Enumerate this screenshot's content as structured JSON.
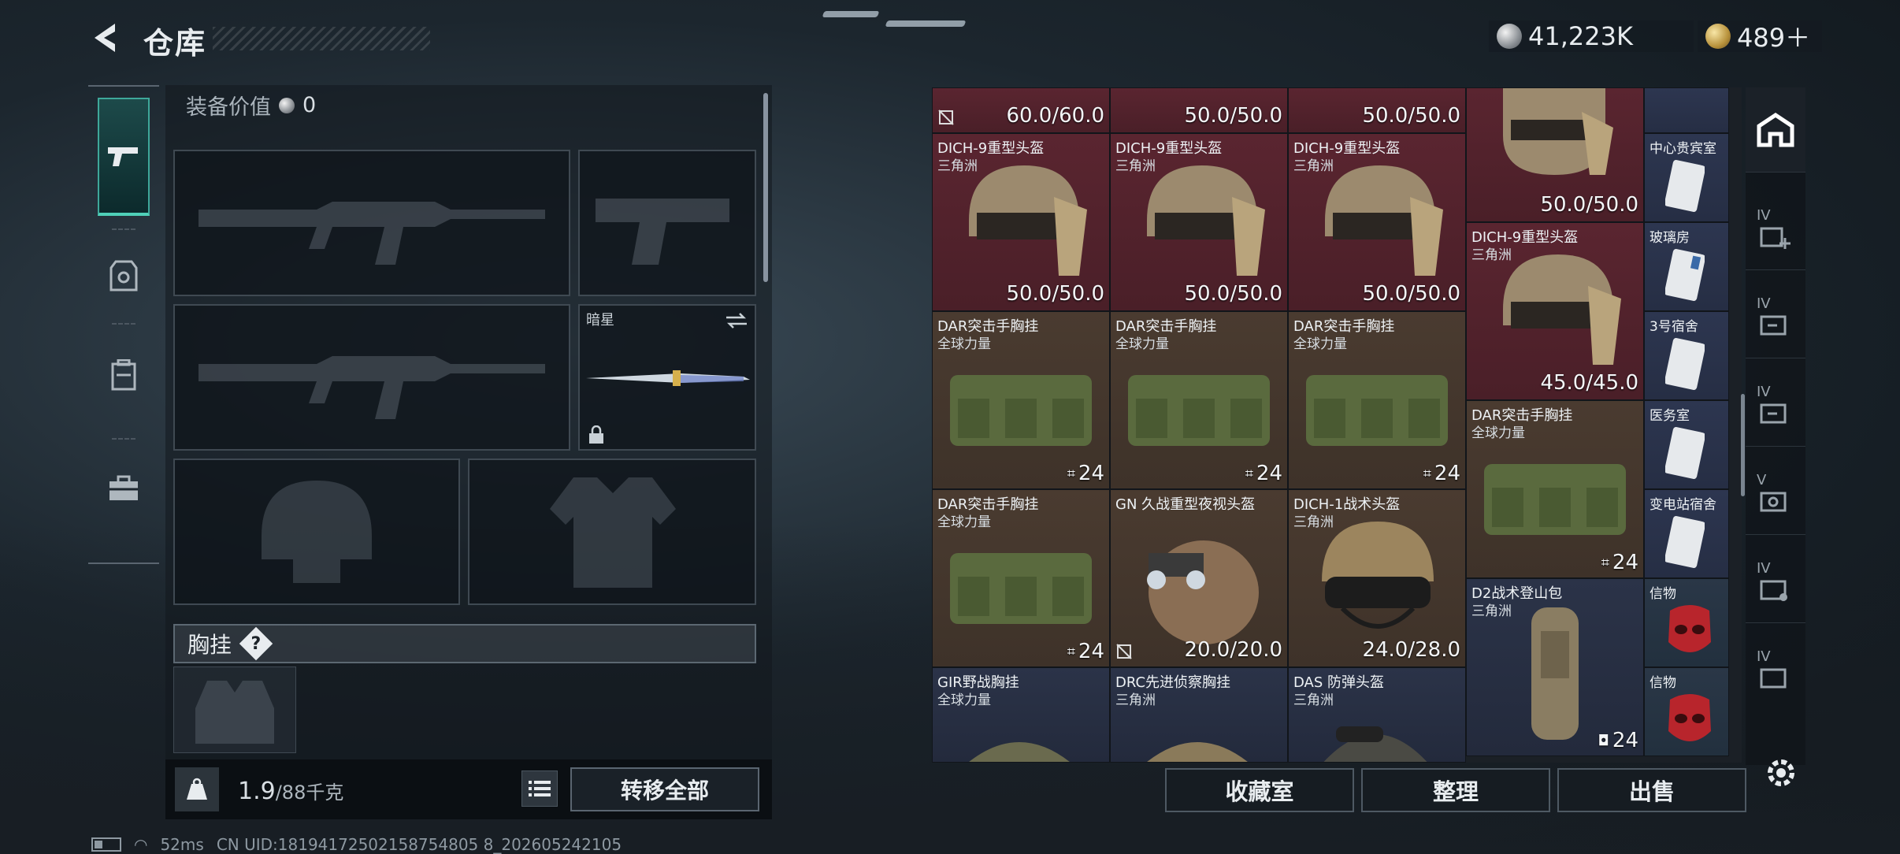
{
  "header": {
    "title": "仓库",
    "currency_silver": "41,223K",
    "currency_gold": "489＋"
  },
  "loadout": {
    "equip_value_label": "装备价值",
    "equip_value": "0",
    "melee_label": "暗星",
    "chest_label": "胸挂",
    "chest_help": "?"
  },
  "weight": {
    "current": "1.9",
    "max": "/88千克"
  },
  "buttons": {
    "transfer_all": "转移全部",
    "collection": "收藏室",
    "sort": "整理",
    "sell": "出售"
  },
  "inventory": {
    "row0": [
      "60.0/60.0",
      "50.0/50.0",
      "50.0/50.0"
    ],
    "helmet_name": "DICH-9重型头盔",
    "brand_delta": "三角洲",
    "brand_global": "全球力量",
    "rig_name": "DAR突击手胸挂",
    "helmet_dur": "50.0/50.0",
    "helmet_dur2": "45.0/45.0",
    "cap24": "24",
    "gn_name": "GN 久战重型夜视头盔",
    "gn_dur": "20.0/20.0",
    "dich1_name": "DICH-1战术头盔",
    "dich1_dur": "24.0/28.0",
    "d2_name": "D2战术登山包",
    "gir_name": "GIR野战胸挂",
    "drc_name": "DRC先进侦察胸挂",
    "das_name": "DAS 防弹头盔",
    "keys": [
      "中心贵宾室",
      "玻璃房",
      "3号宿舍",
      "医务室",
      "变电站宿舍",
      "信物",
      "信物"
    ]
  },
  "rightnav": {
    "tier": "IV",
    "tier_v": "V"
  },
  "status": {
    "ping": "52ms",
    "uid": "CN UID:18194172502158754805 8_202605242105"
  },
  "colors": {
    "accent": "#4fd0b8",
    "red_cell": "#5a2530",
    "brown_cell": "#4a3b30"
  }
}
